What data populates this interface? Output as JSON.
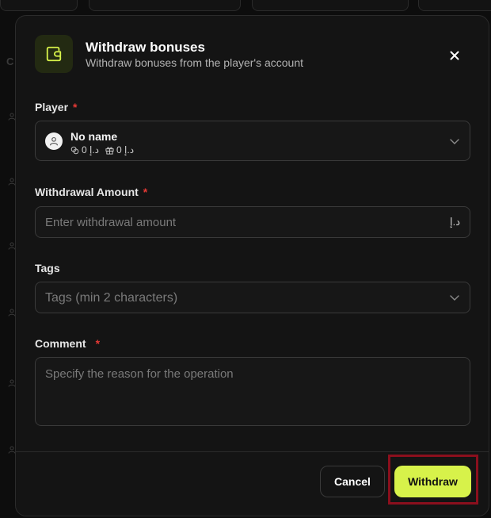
{
  "modal": {
    "title": "Withdraw bonuses",
    "subtitle": "Withdraw bonuses from the player's account"
  },
  "player": {
    "label": "Player",
    "required_mark": "*",
    "name": "No name",
    "balance_1": "0 د.إ",
    "balance_2": "0 د.إ"
  },
  "amount": {
    "label": "Withdrawal Amount",
    "required_mark": "*",
    "placeholder": "Enter withdrawal amount",
    "currency": "د.إ"
  },
  "tags": {
    "label": "Tags",
    "placeholder": "Tags (min 2 characters)"
  },
  "comment": {
    "label": "Comment",
    "required_mark": "*",
    "placeholder": "Specify the reason for the operation"
  },
  "footer": {
    "cancel_label": "Cancel",
    "withdraw_label": "Withdraw"
  },
  "colors": {
    "accent": "#d7f24a",
    "required": "#e53935",
    "highlight_border": "#8b0f1d"
  }
}
